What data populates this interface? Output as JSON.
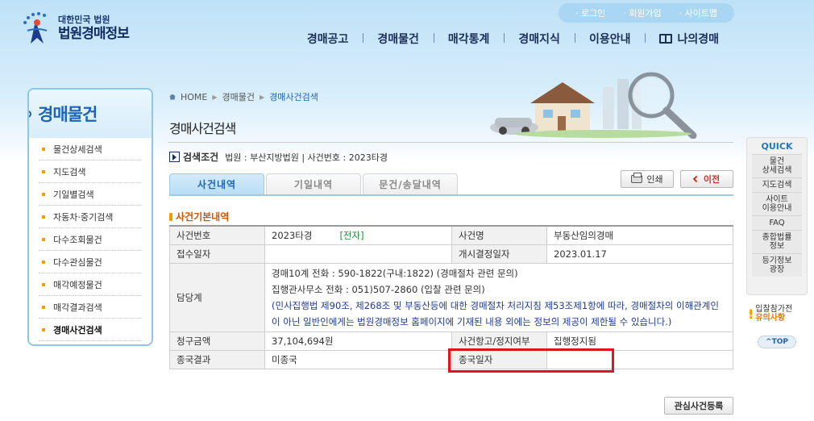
{
  "logo": {
    "small": "대한민국 법원",
    "big": "법원경매정보"
  },
  "util": [
    "로그인",
    "회원가입",
    "사이트맵"
  ],
  "gnb": [
    "경매공고",
    "경매물건",
    "매각통계",
    "경매지식",
    "이용안내",
    "나의경매"
  ],
  "sidebar": {
    "title": "경매물건",
    "items": [
      "물건상세검색",
      "지도검색",
      "기일별검색",
      "자동차·중기검색",
      "다수조회물건",
      "다수관심물건",
      "매각예정물건",
      "매각결과검색",
      "경매사건검색"
    ]
  },
  "breadcrumb": [
    "HOME",
    "경매물건",
    "경매사건검색"
  ],
  "page_title": "경매사건검색",
  "search_cond": {
    "label": "검색조건",
    "value": "법원 : 부산지방법원 | 사건번호 : 2023타경"
  },
  "buttons": {
    "print": "인쇄",
    "back": "이전",
    "register": "관심사건등록"
  },
  "tabs": [
    "사건내역",
    "기일내역",
    "문건/송달내역"
  ],
  "section_title": "사건기본내역",
  "table": {
    "case_no_label": "사건번호",
    "case_no": "2023타경",
    "e_tag": "[전자]",
    "case_name_label": "사건명",
    "case_name": "부동산임의경매",
    "receipt_label": "접수일자",
    "receipt": "",
    "start_label": "개시결정일자",
    "start": "2023.01.17",
    "dept_label": "담당계",
    "dept_line1": "경매10계    전화 : 590-1822(구내:1822) (경매절차 관련 문의)",
    "dept_line2": "집행관사무소    전화 : 051)507-2860 (입찰 관련 문의)",
    "dept_note": "(민사집행법 제90조, 제268조 및 부동산등에 대한 경매절차 처리지침 제53조제1항에 따라, 경매절차의 이해관계인이 아닌 일반인에게는 법원경매정보 홈페이지에 기재된 내용 외에는 정보의 제공이 제한될 수 있습니다.)",
    "claim_label": "청구금액",
    "claim": "37,104,694원",
    "appeal_label": "사건항고/정지여부",
    "appeal": "집행정지됨",
    "result_label": "종국결과",
    "result": "미종국",
    "end_label": "종국일자",
    "end": ""
  },
  "quick": {
    "title": "QUICK",
    "items": [
      "물건\n상세검색",
      "지도검색",
      "사이트\n이용안내",
      "FAQ",
      "종합법률\n정보",
      "등기정보\n광장"
    ]
  },
  "notice": {
    "line1": "입찰참가전",
    "line2": "유의사항"
  },
  "top": "TOP",
  "colors": {
    "accent": "#1e64b4",
    "highlight": "#e0141c",
    "orange": "#f29b00"
  }
}
